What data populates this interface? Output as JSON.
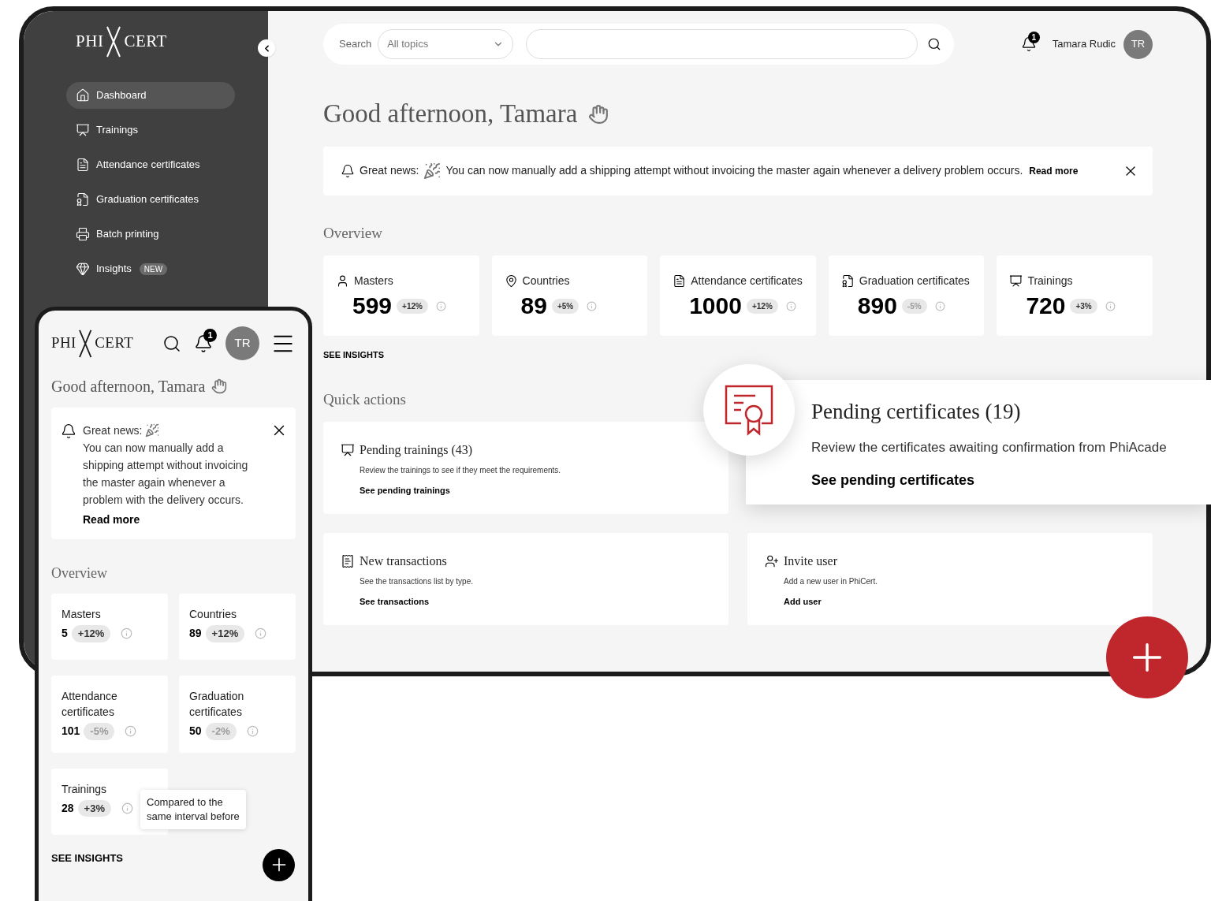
{
  "desktop": {
    "logo": {
      "left": "PHI",
      "right": "CERT"
    },
    "sidebar": {
      "items": [
        {
          "label": "Dashboard",
          "selected": true
        },
        {
          "label": "Trainings",
          "selected": false
        },
        {
          "label": "Attendance certificates",
          "selected": false
        },
        {
          "label": "Graduation certificates",
          "selected": false
        },
        {
          "label": "Batch printing",
          "selected": false
        },
        {
          "label": "Insights",
          "badge": "NEW",
          "selected": false
        }
      ]
    },
    "search": {
      "label": "Search",
      "topic": "All topics"
    },
    "user": {
      "notifications": "1",
      "name": "Tamara Rudic",
      "initials": "TR"
    },
    "greeting": "Good afternoon, Tamara",
    "banner": {
      "lead": "Great news:",
      "text": "You can now manually add a shipping attempt without invoicing the master again whenever a delivery problem occurs.",
      "link": "Read more"
    },
    "overview": {
      "title": "Overview",
      "link": "SEE INSIGHTS",
      "stats": [
        {
          "label": "Masters",
          "value": "599",
          "change": "+12%",
          "negative": false
        },
        {
          "label": "Countries",
          "value": "89",
          "change": "+5%",
          "negative": false
        },
        {
          "label": "Attendance certificates",
          "value": "1000",
          "change": "+12%",
          "negative": false
        },
        {
          "label": "Graduation certificates",
          "value": "890",
          "change": "-5%",
          "negative": true
        },
        {
          "label": "Trainings",
          "value": "720",
          "change": "+3%",
          "negative": false
        }
      ]
    },
    "quick_actions": {
      "title": "Quick actions",
      "items": [
        {
          "title": "Pending trainings (43)",
          "text": "Review the trainings to see if they meet the requirements.",
          "link": "See pending trainings"
        },
        {
          "title": "New transactions",
          "text": "See the transactions list by type.",
          "link": "See transactions"
        },
        {
          "title": "Invite user",
          "text": "Add a new user in PhiCert.",
          "link": "Add user"
        }
      ]
    },
    "pending": {
      "title": "Pending certificates (19)",
      "text": "Review the certificates awaiting confirmation from PhiAcade",
      "link": "See pending certificates"
    }
  },
  "mobile": {
    "logo": {
      "left": "PHI",
      "right": "CERT"
    },
    "user": {
      "notifications": "1",
      "initials": "TR"
    },
    "greeting": "Good afternoon, Tamara",
    "banner": {
      "lead": "Great news:",
      "text": "You can now manually add a shipping attempt without invoicing the master again whenever a problem with the delivery occurs.",
      "link": "Read more"
    },
    "overview": {
      "title": "Overview",
      "link": "SEE INSIGHTS",
      "stats": [
        {
          "label": "Masters",
          "value": "5",
          "change": "+12%",
          "negative": false
        },
        {
          "label": "Countries",
          "value": "89",
          "change": "+12%",
          "negative": false
        },
        {
          "label": "Attendance certificates",
          "value": "101",
          "change": "-5%",
          "negative": true
        },
        {
          "label": "Graduation certificates",
          "value": "50",
          "change": "-2%",
          "negative": true
        },
        {
          "label": "Trainings",
          "value": "28",
          "change": "+3%",
          "negative": false,
          "tooltip": "Compared to the same interval before"
        }
      ]
    }
  }
}
